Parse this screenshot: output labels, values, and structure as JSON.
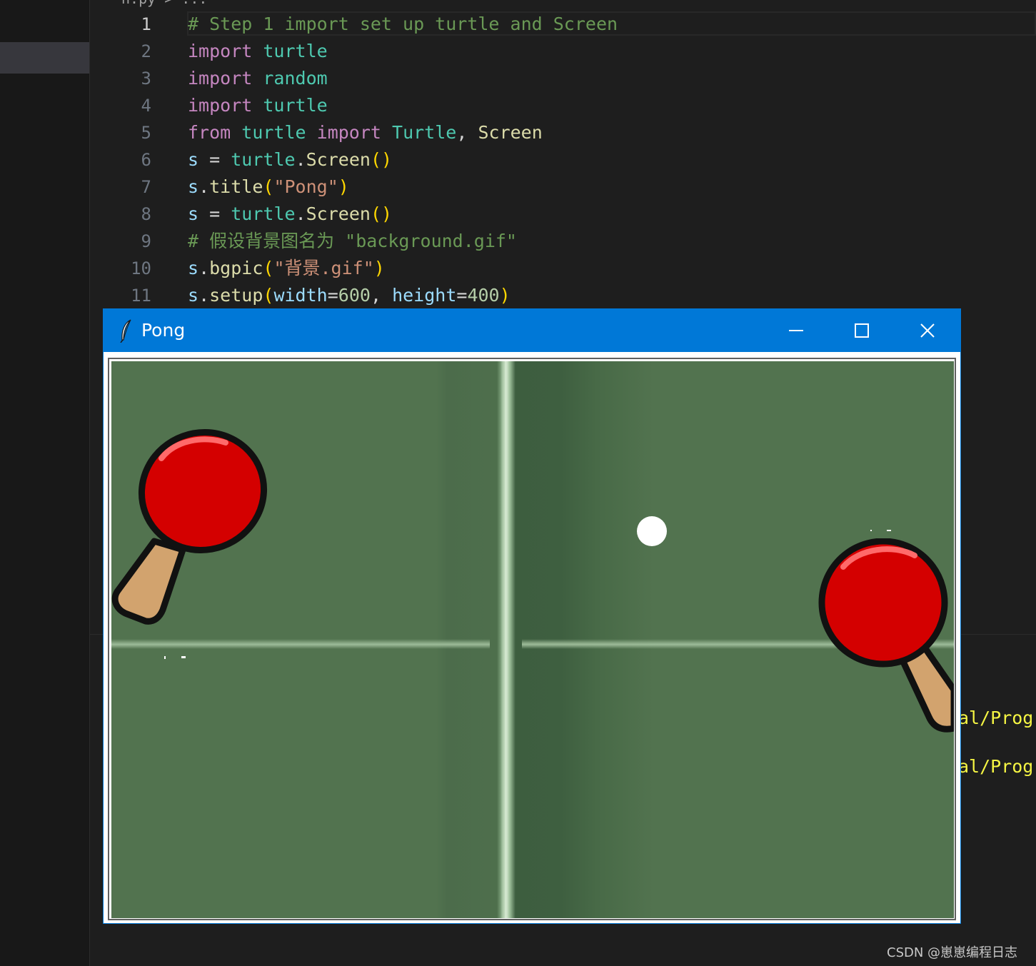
{
  "breadcrumb": "n.py > ...",
  "editor": {
    "lines": [
      {
        "n": "1"
      },
      {
        "n": "2"
      },
      {
        "n": "3"
      },
      {
        "n": "4"
      },
      {
        "n": "5"
      },
      {
        "n": "6"
      },
      {
        "n": "7"
      },
      {
        "n": "8"
      },
      {
        "n": "9"
      },
      {
        "n": "10"
      },
      {
        "n": "11"
      }
    ],
    "tokens": {
      "l1_comment": "# Step 1 import set up turtle and Screen",
      "kw_import": "import",
      "kw_from": "from",
      "mod_turtle": "turtle",
      "mod_random": "random",
      "cls_turtle": "Turtle",
      "comma": ",",
      "cls_screen": "Screen",
      "var_s": "s",
      "eq": "=",
      "dot": ".",
      "call_screen": "Screen",
      "open": "(",
      "close": ")",
      "fn_title": "title",
      "str_pong": "\"Pong\"",
      "l9_comment": "# 假设背景图名为 \"background.gif\"",
      "fn_bgpic": "bgpic",
      "str_bg": "\"背景.gif\"",
      "fn_setup": "setup",
      "param_width": "width",
      "val_600": "600",
      "param_height": "height",
      "val_400": "400"
    }
  },
  "terminal": {
    "line1": "al/Progr",
    "line2": "al/Progr"
  },
  "pong_window": {
    "title": "Pong",
    "minimize_icon": "minimize-icon",
    "maximize_icon": "maximize-icon",
    "close_icon": "close-icon",
    "background_image": "背景.gif"
  },
  "watermark": "CSDN @崽崽编程日志",
  "colors": {
    "titlebar": "#0078d7",
    "table_green": "#52734f",
    "paddle_red": "#d40000",
    "handle_tan": "#d2a36e"
  }
}
